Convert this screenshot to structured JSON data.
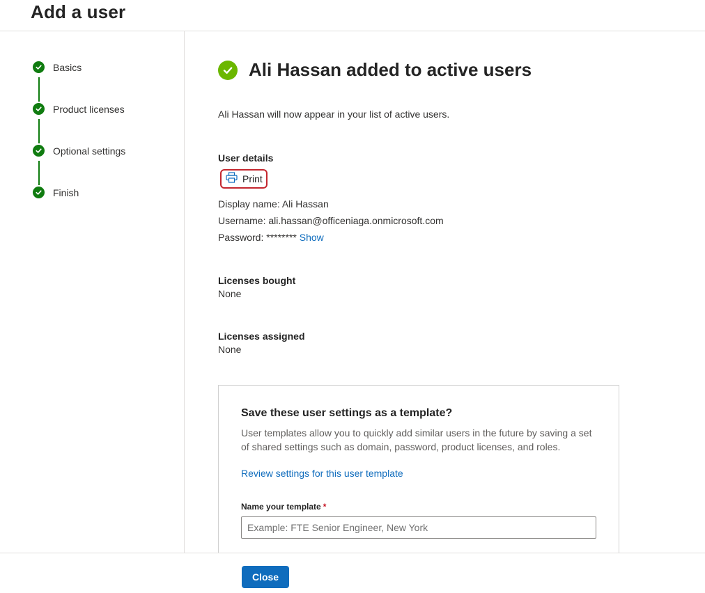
{
  "header": {
    "title": "Add a user"
  },
  "steps": [
    {
      "label": "Basics",
      "status": "complete"
    },
    {
      "label": "Product licenses",
      "status": "complete"
    },
    {
      "label": "Optional settings",
      "status": "complete"
    },
    {
      "label": "Finish",
      "status": "complete"
    }
  ],
  "success": {
    "title": "Ali Hassan added to active users",
    "message": "Ali Hassan will now appear in your list of active users."
  },
  "user_details": {
    "heading": "User details",
    "print_label": "Print",
    "display_name": "Display name: Ali Hassan",
    "username": "Username: ali.hassan@officeniaga.onmicrosoft.com",
    "password": "Password: ********",
    "show_label": "Show"
  },
  "licenses_bought": {
    "heading": "Licenses bought",
    "value": "None"
  },
  "licenses_assigned": {
    "heading": "Licenses assigned",
    "value": "None"
  },
  "template": {
    "title": "Save these user settings as a template?",
    "description": "User templates allow you to quickly add similar users in the future by saving a set of shared settings such as domain, password, product licenses, and roles.",
    "review_link": "Review settings for this user template",
    "name_label": "Name your template",
    "required_marker": "*",
    "name_placeholder": "Example: FTE Senior Engineer, New York",
    "name_value": ""
  },
  "footer": {
    "close_label": "Close"
  },
  "colors": {
    "accent": "#0f6cbd",
    "step_complete": "#107c10",
    "success": "#6bb700",
    "highlight": "#c4262e"
  }
}
